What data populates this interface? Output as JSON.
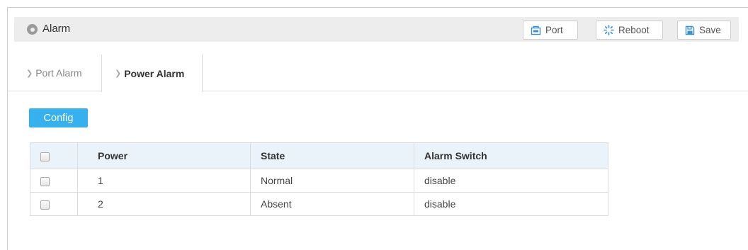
{
  "header": {
    "title": "Alarm",
    "buttons": {
      "port": "Port",
      "reboot": "Reboot",
      "save": "Save"
    }
  },
  "tabs": [
    {
      "label": "Port Alarm",
      "active": false
    },
    {
      "label": "Power Alarm",
      "active": true
    }
  ],
  "config_label": "Config",
  "table": {
    "columns": [
      "Power",
      "State",
      "Alarm Switch"
    ],
    "rows": [
      {
        "power": "1",
        "state": "Normal",
        "alarm_switch": "disable"
      },
      {
        "power": "2",
        "state": "Absent",
        "alarm_switch": "disable"
      }
    ]
  },
  "colors": {
    "accent": "#35b1f0",
    "header_bg": "#eaf3f9",
    "titlebar_bg": "#ededed"
  }
}
